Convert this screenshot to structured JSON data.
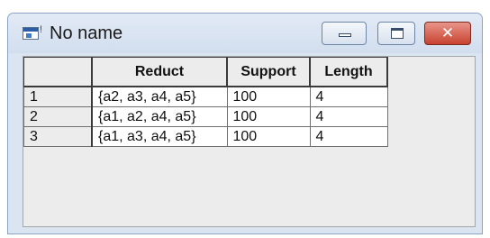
{
  "window": {
    "title": "No name",
    "icon": "application-window-icon",
    "buttons": [
      "minimize-icon",
      "maximize-icon",
      "close-icon"
    ],
    "close_color": "#c8422f"
  },
  "table": {
    "columns": [
      "",
      "Reduct",
      "Support",
      "Length"
    ],
    "rows": [
      {
        "index": "1",
        "reduct": "{a2, a3, a4, a5}",
        "support": "100",
        "length": "4"
      },
      {
        "index": "2",
        "reduct": "{a1, a2, a4, a5}",
        "support": "100",
        "length": "4"
      },
      {
        "index": "3",
        "reduct": "{a1, a3, a4, a5}",
        "support": "100",
        "length": "4"
      }
    ]
  }
}
